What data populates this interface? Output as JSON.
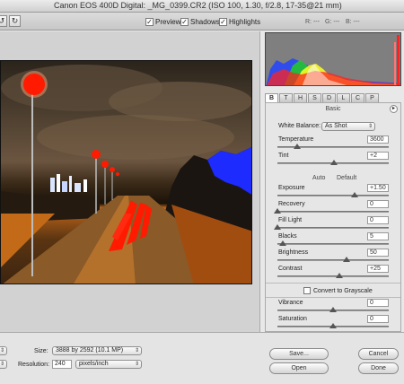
{
  "window": {
    "title": "Canon EOS 400D Digital: _MG_0399.CR2  (ISO 100, 1.30, f/2.8, 17-35@21 mm)"
  },
  "toolbar": {
    "rotate_icon": "rotate-icon",
    "preview": {
      "label": "Preview",
      "checked": true
    },
    "shadows": {
      "label": "Shadows",
      "checked": true
    },
    "highlights": {
      "label": "Highlights",
      "checked": true
    },
    "r": "R: ---",
    "g": "G: ---",
    "b": "B: ---"
  },
  "tabs": [
    "B",
    "T",
    "H",
    "S",
    "D",
    "L",
    "C",
    "P"
  ],
  "panel": {
    "title": "Basic",
    "white_balance": {
      "label": "White Balance:",
      "value": "As Shot"
    },
    "temperature": {
      "label": "Temperature",
      "value": "3600",
      "level": 0.18
    },
    "tint": {
      "label": "Tint",
      "value": "+2",
      "level": 0.51
    },
    "auto": "Auto",
    "default": "Default",
    "exposure": {
      "label": "Exposure",
      "value": "+1.50",
      "level": 0.69
    },
    "recovery": {
      "label": "Recovery",
      "value": "0",
      "level": 0.0
    },
    "fill_light": {
      "label": "Fill Light",
      "value": "0",
      "level": 0.0
    },
    "blacks": {
      "label": "Blacks",
      "value": "5",
      "level": 0.05
    },
    "brightness": {
      "label": "Brightness",
      "value": "50",
      "level": 0.62
    },
    "contrast": {
      "label": "Contrast",
      "value": "+25",
      "level": 0.56
    },
    "grayscale": {
      "label": "Convert to Grayscale",
      "checked": false
    },
    "vibrance": {
      "label": "Vibrance",
      "value": "0",
      "level": 0.5
    },
    "saturation": {
      "label": "Saturation",
      "value": "0",
      "level": 0.5
    }
  },
  "bottom": {
    "size_label": "Size:",
    "size_value": "3888 by 2592  (10.1 MP)",
    "resolution_label": "Resolution:",
    "resolution_value": "240",
    "resolution_unit": "pixels/inch",
    "save": "Save...",
    "open": "Open",
    "cancel": "Cancel",
    "done": "Done"
  }
}
